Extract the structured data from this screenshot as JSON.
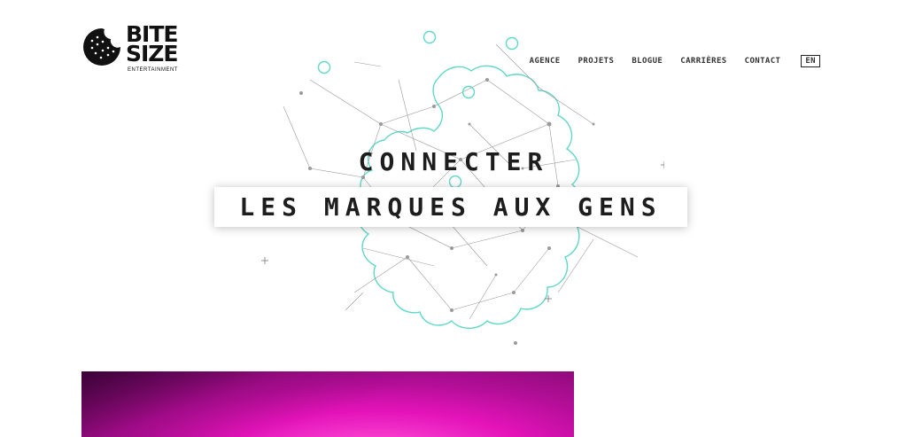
{
  "brand": {
    "line1": "BITE",
    "line2": "SIZE",
    "subtitle": "ENTERTAINMENT",
    "accent_color": "#5fd8c8",
    "hero_color": "#e413b9"
  },
  "nav": {
    "items": [
      "AGENCE",
      "PROJETS",
      "BLOGUE",
      "CARRIÈRES",
      "CONTACT"
    ],
    "lang": "EN"
  },
  "hero": {
    "line1": "CONNECTER",
    "line2": "LES MARQUES AUX GENS"
  }
}
